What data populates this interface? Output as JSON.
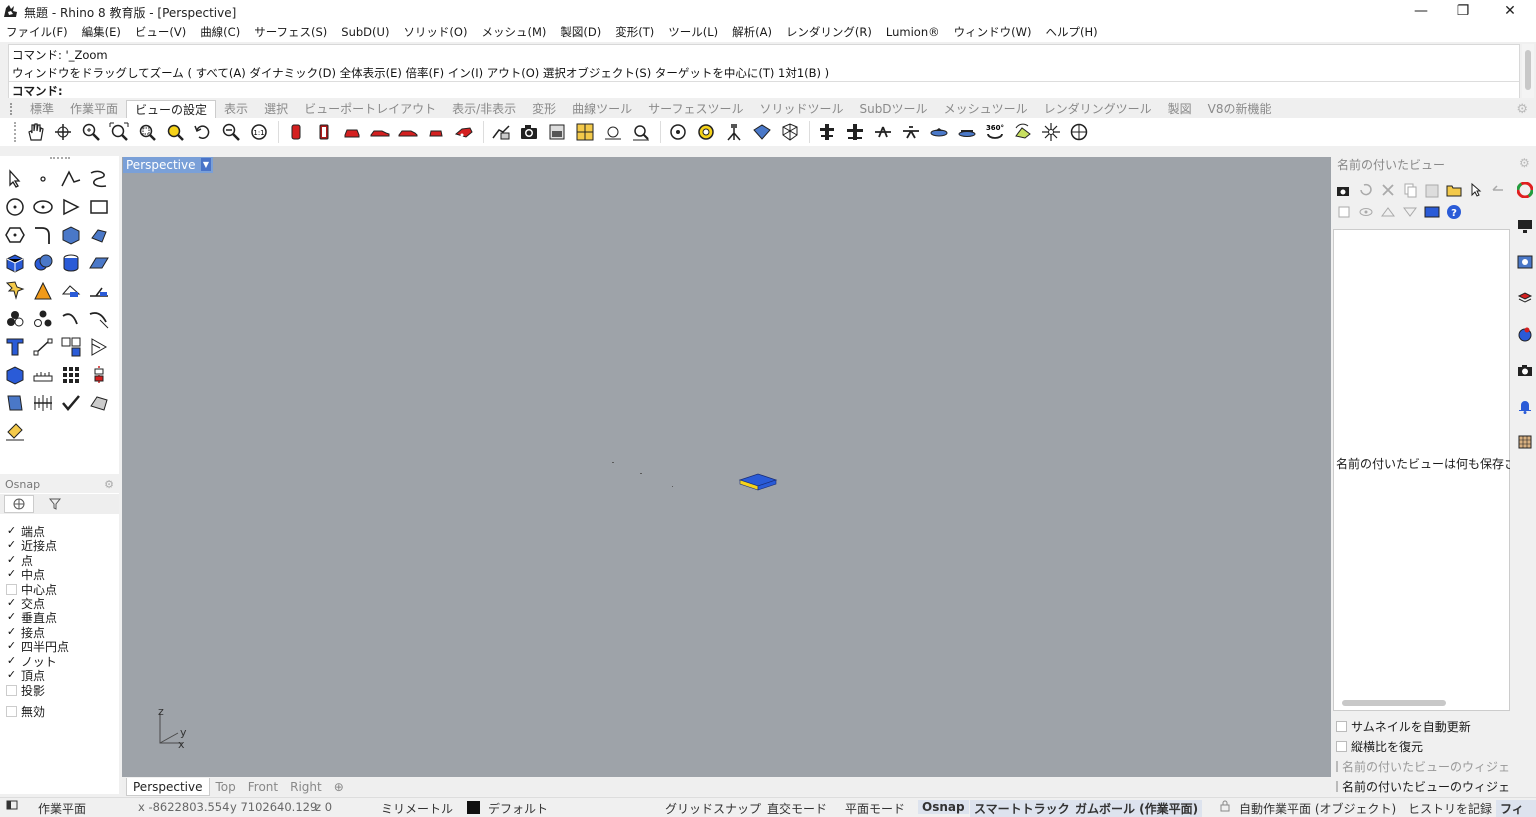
{
  "window": {
    "title": "無題 - Rhino 8 教育版 - [Perspective]",
    "minimize": "—",
    "restore": "❐",
    "close": "✕"
  },
  "menu": [
    "ファイル(F)",
    "編集(E)",
    "ビュー(V)",
    "曲線(C)",
    "サーフェス(S)",
    "SubD(U)",
    "ソリッド(O)",
    "メッシュ(M)",
    "製図(D)",
    "変形(T)",
    "ツール(L)",
    "解析(A)",
    "レンダリング(R)",
    "Lumion®",
    "ウィンドウ(W)",
    "ヘルプ(H)"
  ],
  "command": {
    "line1": "コマンド: '_Zoom",
    "line2": "ウィンドウをドラッグしてズーム ( すべて(A)  ダイナミック(D)  全体表示(E)  倍率(F)  イン(I)  アウト(O)  選択オブジェクト(S)  ターゲットを中心に(T)  1対1(B) )",
    "prompt": "コマンド:"
  },
  "toolbar_tabs": [
    "標準",
    "作業平面",
    "ビューの設定",
    "表示",
    "選択",
    "ビューポートレイアウト",
    "表示/非表示",
    "変形",
    "曲線ツール",
    "サーフェスツール",
    "ソリッドツール",
    "SubDツール",
    "メッシュツール",
    "レンダリングツール",
    "製図",
    "V8の新機能"
  ],
  "active_toolbar_tab": "ビューの設定",
  "gear": "⚙",
  "osnap": {
    "title": "Osnap",
    "items": [
      {
        "label": "端点",
        "checked": true
      },
      {
        "label": "近接点",
        "checked": true
      },
      {
        "label": "点",
        "checked": true
      },
      {
        "label": "中点",
        "checked": true
      },
      {
        "label": "中心点",
        "checked": false
      },
      {
        "label": "交点",
        "checked": true
      },
      {
        "label": "垂直点",
        "checked": true
      },
      {
        "label": "接点",
        "checked": true
      },
      {
        "label": "四半円点",
        "checked": true
      },
      {
        "label": "ノット",
        "checked": true
      },
      {
        "label": "頂点",
        "checked": true
      },
      {
        "label": "投影",
        "checked": false
      }
    ],
    "disable": {
      "label": "無効",
      "checked": false
    }
  },
  "viewport": {
    "label": "Perspective",
    "axes": {
      "z": "z",
      "y": "y",
      "x": "x"
    }
  },
  "view_tabs": [
    "Perspective",
    "Top",
    "Front",
    "Right"
  ],
  "view_tab_add": "⊕",
  "named_views": {
    "title": "名前の付いたビュー",
    "empty_text": "名前の付いたビューは何も保存されていません",
    "options": [
      {
        "label": "サムネイルを自動更新",
        "checked": false,
        "dim": false
      },
      {
        "label": "縦横比を復元",
        "checked": false,
        "dim": false
      },
      {
        "label": "名前の付いたビューのウィジェット",
        "checked": false,
        "dim": true
      },
      {
        "label": "名前の付いたビューのウィジェット",
        "checked": false,
        "dim": false
      }
    ]
  },
  "status": {
    "cplane": "作業平面",
    "x": "x -8622803.554",
    "y": "y 7102640.129",
    "z": "z 0",
    "units": "ミリメートル",
    "layer": "デフォルト",
    "grid_snap": "グリッドスナップ",
    "ortho": "直交モード",
    "planar": "平面モード",
    "osnap": "Osnap",
    "smarttrack": "スマートトラック",
    "gumball": "ガムボール (作業平面)",
    "auto_cplane": "自動作業平面 (オブジェクト)",
    "history": "ヒストリを記録",
    "filter": "フィ"
  },
  "colors": {
    "viewport_bg": "#9ea3a9",
    "viewport_label": "#7aa0d8",
    "accent_red": "#d42020",
    "accent_blue": "#2a5bd7"
  }
}
